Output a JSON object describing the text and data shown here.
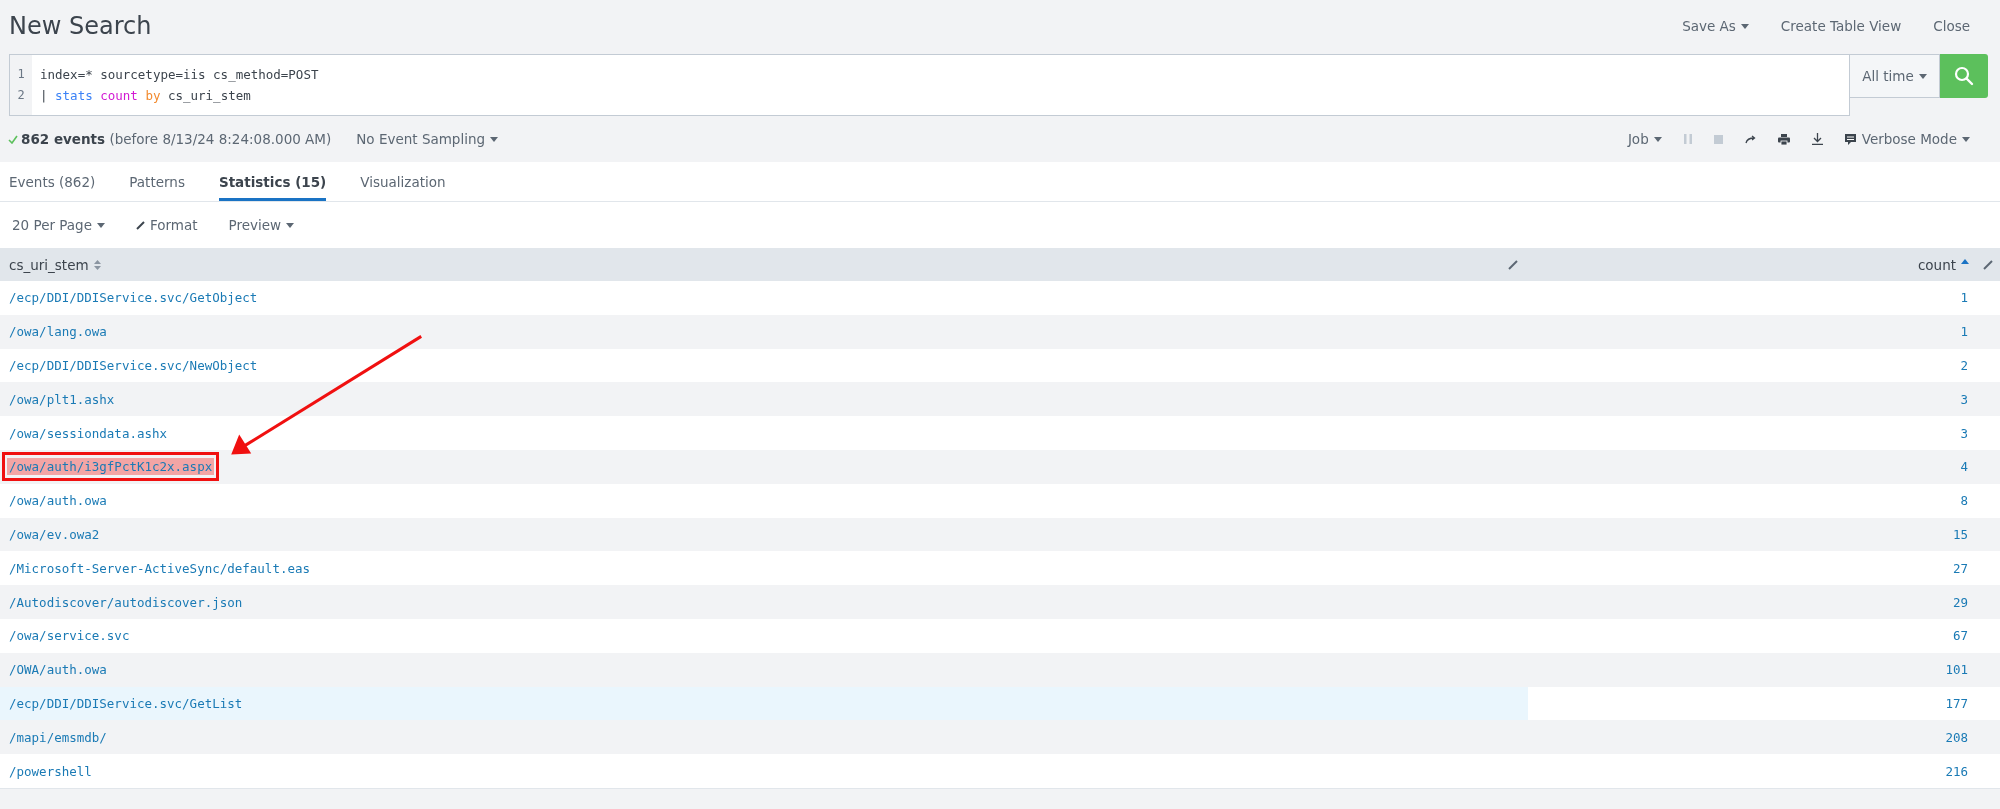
{
  "header": {
    "title": "New Search",
    "actions": [
      {
        "label": "Save As",
        "dropdown": true
      },
      {
        "label": "Create Table View",
        "dropdown": false
      },
      {
        "label": "Close",
        "dropdown": false
      }
    ]
  },
  "query": {
    "lines": [
      {
        "number": "1",
        "tokens": [
          {
            "text": "index=* sourcetype=iis cs_method=POST",
            "kind": "plain"
          }
        ]
      },
      {
        "number": "2",
        "tokens": [
          {
            "text": "| ",
            "kind": "plain"
          },
          {
            "text": "stats ",
            "kind": "command"
          },
          {
            "text": "count ",
            "kind": "function"
          },
          {
            "text": "by",
            "kind": "keyword"
          },
          {
            "text": " cs_uri_stem",
            "kind": "plain"
          }
        ]
      }
    ],
    "time_range": "All time"
  },
  "job_status": {
    "count": "862 events",
    "detail": "(before 8/13/24 8:24:08.000 AM)",
    "sampling": "No Event Sampling",
    "job": "Job",
    "mode": "Verbose Mode"
  },
  "tabs": [
    {
      "label": "Events (862)",
      "selected": false
    },
    {
      "label": "Patterns",
      "selected": false
    },
    {
      "label": "Statistics (15)",
      "selected": true
    },
    {
      "label": "Visualization",
      "selected": false
    }
  ],
  "toolbar": [
    "20 Per Page",
    "Format",
    "Preview"
  ],
  "table": {
    "columns": [
      {
        "label": "cs_uri_stem",
        "sorted": false
      },
      {
        "label": "count",
        "sorted": true
      }
    ],
    "rows": [
      {
        "cells": [
          "/ecp/DDI/DDIService.svc/GetObject",
          "1"
        ],
        "annotated": false,
        "hovered": false
      },
      {
        "cells": [
          "/owa/lang.owa",
          "1"
        ],
        "annotated": false,
        "hovered": false
      },
      {
        "cells": [
          "/ecp/DDI/DDIService.svc/NewObject",
          "2"
        ],
        "annotated": false,
        "hovered": false
      },
      {
        "cells": [
          "/owa/plt1.ashx",
          "3"
        ],
        "annotated": false,
        "hovered": false
      },
      {
        "cells": [
          "/owa/sessiondata.ashx",
          "3"
        ],
        "annotated": false,
        "hovered": false
      },
      {
        "cells": [
          "/owa/auth/i3gfPctK1c2x.aspx",
          "4"
        ],
        "annotated": true,
        "hovered": false
      },
      {
        "cells": [
          "/owa/auth.owa",
          "8"
        ],
        "annotated": false,
        "hovered": false
      },
      {
        "cells": [
          "/owa/ev.owa2",
          "15"
        ],
        "annotated": false,
        "hovered": false
      },
      {
        "cells": [
          "/Microsoft-Server-ActiveSync/default.eas",
          "27"
        ],
        "annotated": false,
        "hovered": false
      },
      {
        "cells": [
          "/Autodiscover/autodiscover.json",
          "29"
        ],
        "annotated": false,
        "hovered": false
      },
      {
        "cells": [
          "/owa/service.svc",
          "67"
        ],
        "annotated": false,
        "hovered": false
      },
      {
        "cells": [
          "/OWA/auth.owa",
          "101"
        ],
        "annotated": false,
        "hovered": false
      },
      {
        "cells": [
          "/ecp/DDI/DDIService.svc/GetList",
          "177"
        ],
        "annotated": false,
        "hovered": true
      },
      {
        "cells": [
          "/mapi/emsmdb/",
          "208"
        ],
        "annotated": false,
        "hovered": false
      },
      {
        "cells": [
          "/powershell",
          "216"
        ],
        "annotated": false,
        "hovered": false
      }
    ]
  }
}
